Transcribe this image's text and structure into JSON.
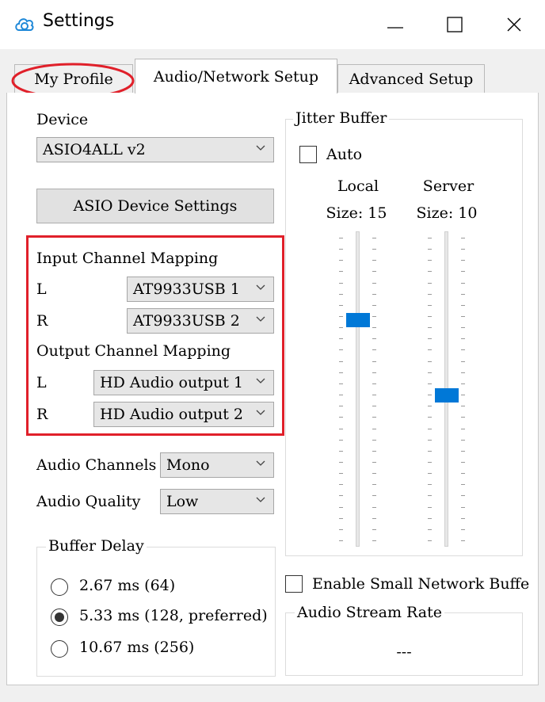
{
  "window": {
    "title": "Settings"
  },
  "tabs": [
    {
      "label": "My Profile"
    },
    {
      "label": "Audio/Network Setup"
    },
    {
      "label": "Advanced Setup"
    }
  ],
  "device": {
    "label": "Device",
    "selected": "ASIO4ALL v2",
    "settings_button": "ASIO Device Settings"
  },
  "input_mapping": {
    "title": "Input Channel Mapping",
    "left_label": "L",
    "left_value": "AT9933USB 1",
    "right_label": "R",
    "right_value": "AT9933USB 2"
  },
  "output_mapping": {
    "title": "Output Channel Mapping",
    "left_label": "L",
    "left_value": "HD Audio output 1",
    "right_label": "R",
    "right_value": "HD Audio output 2"
  },
  "audio": {
    "channels_label": "Audio Channels",
    "channels_value": "Mono",
    "quality_label": "Audio Quality",
    "quality_value": "Low"
  },
  "buffer_delay": {
    "title": "Buffer Delay",
    "options": [
      {
        "label": "2.67 ms (64)",
        "selected": false
      },
      {
        "label": "5.33 ms (128, preferred)",
        "selected": true
      },
      {
        "label": "10.67 ms (256)",
        "selected": false
      }
    ]
  },
  "jitter_buffer": {
    "title": "Jitter Buffer",
    "auto_label": "Auto",
    "auto_checked": false,
    "local_label": "Local",
    "local_size": "Size: 15",
    "local_level_fraction": 0.27,
    "server_label": "Server",
    "server_size": "Size: 10",
    "server_level_fraction": 0.52
  },
  "small_network_buffer": {
    "label": "Enable Small Network Buffe",
    "checked": false
  },
  "audio_stream_rate": {
    "title": "Audio Stream Rate",
    "value": "---"
  },
  "colors": {
    "accent": "#0078d7",
    "highlight": "#e0202a"
  }
}
